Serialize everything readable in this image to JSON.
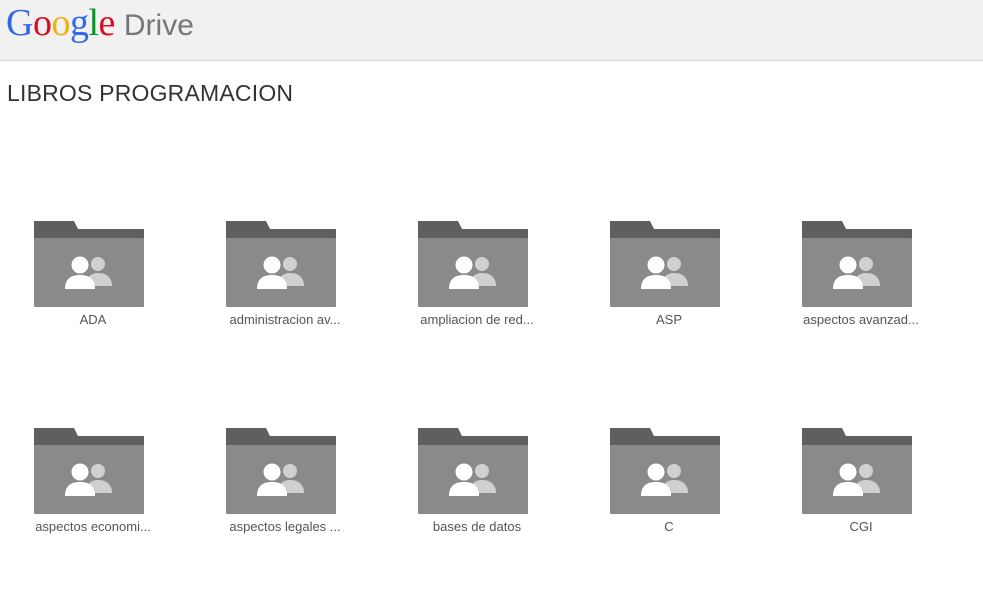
{
  "header": {
    "logo_letters": [
      {
        "char": "G",
        "color": "#3369e8"
      },
      {
        "char": "o",
        "color": "#d50f25"
      },
      {
        "char": "o",
        "color": "#eeb211"
      },
      {
        "char": "g",
        "color": "#3369e8"
      },
      {
        "char": "l",
        "color": "#009925"
      },
      {
        "char": "e",
        "color": "#d50f25"
      }
    ],
    "product_name": "Drive"
  },
  "page": {
    "title": "LIBROS PROGRAMACION"
  },
  "folders": [
    {
      "label": "ADA",
      "icon": "shared-folder-icon"
    },
    {
      "label": "administracion av...",
      "icon": "shared-folder-icon"
    },
    {
      "label": "ampliacion de red...",
      "icon": "shared-folder-icon"
    },
    {
      "label": "ASP",
      "icon": "shared-folder-icon"
    },
    {
      "label": "aspectos avanzad...",
      "icon": "shared-folder-icon"
    },
    {
      "label": "aspectos economi...",
      "icon": "shared-folder-icon"
    },
    {
      "label": "aspectos legales ...",
      "icon": "shared-folder-icon"
    },
    {
      "label": "bases de datos",
      "icon": "shared-folder-icon"
    },
    {
      "label": "C",
      "icon": "shared-folder-icon"
    },
    {
      "label": "CGI",
      "icon": "shared-folder-icon"
    }
  ],
  "colors": {
    "folder_tab": "#5f5f5f",
    "folder_body": "#8a8a8a",
    "people_front": "#ffffff",
    "people_back": "#d0d0d0",
    "header_bg": "#f1f1f1"
  }
}
